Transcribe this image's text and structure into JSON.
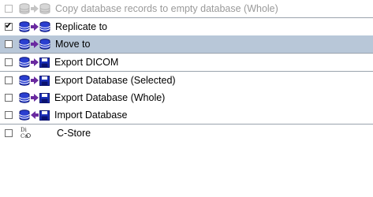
{
  "items": [
    {
      "label": "Copy database records to empty database (Whole)",
      "checked": false,
      "disabled": true
    },
    {
      "label": "Replicate to",
      "checked": true
    },
    {
      "label": "Move to",
      "checked": false,
      "selected": true
    },
    {
      "label": "Export DICOM",
      "checked": false
    },
    {
      "label": "Export Database (Selected)",
      "checked": false
    },
    {
      "label": "Export Database (Whole)",
      "checked": false
    },
    {
      "label": "Import Database",
      "checked": false
    },
    {
      "label": "C-Store",
      "checked": false
    }
  ],
  "icons": {
    "dicom_text": "Di\nCo"
  },
  "colors": {
    "selected_row": "#b8c7d8",
    "separator": "#9aa3ad",
    "disabled_text": "#9a9a9a",
    "db_blue": "#1b2fb8",
    "arrow_purple": "#6a2aa0",
    "disk_blue": "#1b2fb8"
  }
}
